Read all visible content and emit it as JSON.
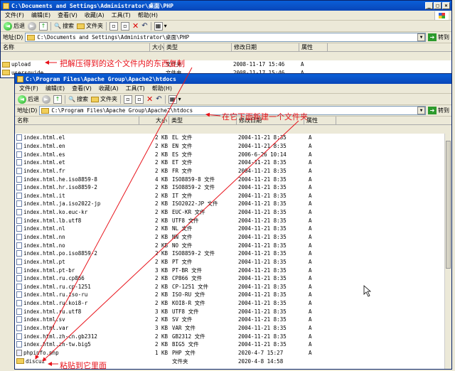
{
  "back_window": {
    "title": "C:\\Documents and Settings\\Administrator\\桌面\\PHP",
    "menu": [
      "文件(F)",
      "编辑(E)",
      "查看(V)",
      "收藏(A)",
      "工具(T)",
      "帮助(H)"
    ],
    "toolbar": {
      "back": "后退",
      "search": "搜索",
      "folders": "文件夹"
    },
    "address_label": "地址(D)",
    "address": "C:\\Documents and Settings\\Administrator\\桌面\\PHP",
    "go": "转到",
    "columns": [
      "名称",
      "大小",
      "类型",
      "修改日期",
      "属性"
    ],
    "rows": [
      {
        "name": "upload",
        "size": "",
        "type": "文件夹",
        "date": "2008-11-17 15:46",
        "attr": "A"
      },
      {
        "name": "usersguide",
        "size": "",
        "type": "文件夹",
        "date": "2008-11-17 15:46",
        "attr": "A"
      }
    ]
  },
  "front_window": {
    "title": "C:\\Program Files\\Apache Group\\Apache2\\htdocs",
    "menu": [
      "文件(F)",
      "编辑(E)",
      "查看(V)",
      "收藏(A)",
      "工具(T)",
      "帮助(H)"
    ],
    "toolbar": {
      "back": "后退",
      "search": "搜索",
      "folders": "文件夹"
    },
    "address_label": "地址(D)",
    "address": "C:\\Program Files\\Apache Group\\Apache2\\htdocs",
    "go": "转到",
    "columns": [
      "名称",
      "大小",
      "类型",
      "修改日期",
      "属性"
    ],
    "rows": [
      {
        "name": "index.html.el",
        "size": "2 KB",
        "type": "EL 文件",
        "date": "2004-11-21 8:35",
        "attr": "A"
      },
      {
        "name": "index.html.en",
        "size": "2 KB",
        "type": "EN 文件",
        "date": "2004-11-21 8:35",
        "attr": "A"
      },
      {
        "name": "index.html.es",
        "size": "2 KB",
        "type": "ES 文件",
        "date": "2006-6-26 10:14",
        "attr": "A"
      },
      {
        "name": "index.html.et",
        "size": "2 KB",
        "type": "ET 文件",
        "date": "2004-11-21 8:35",
        "attr": "A"
      },
      {
        "name": "index.html.fr",
        "size": "2 KB",
        "type": "FR 文件",
        "date": "2004-11-21 8:35",
        "attr": "A"
      },
      {
        "name": "index.html.he.iso8859-8",
        "size": "4 KB",
        "type": "ISO8859-8 文件",
        "date": "2004-11-21 8:35",
        "attr": "A"
      },
      {
        "name": "index.html.hr.iso8859-2",
        "size": "2 KB",
        "type": "ISO8859-2 文件",
        "date": "2004-11-21 8:35",
        "attr": "A"
      },
      {
        "name": "index.html.it",
        "size": "2 KB",
        "type": "IT 文件",
        "date": "2004-11-21 8:35",
        "attr": "A"
      },
      {
        "name": "index.html.ja.iso2022-jp",
        "size": "2 KB",
        "type": "ISO2022-JP 文件",
        "date": "2004-11-21 8:35",
        "attr": "A"
      },
      {
        "name": "index.html.ko.euc-kr",
        "size": "2 KB",
        "type": "EUC-KR 文件",
        "date": "2004-11-21 8:35",
        "attr": "A"
      },
      {
        "name": "index.html.lb.utf8",
        "size": "2 KB",
        "type": "UTF8 文件",
        "date": "2004-11-21 8:35",
        "attr": "A"
      },
      {
        "name": "index.html.nl",
        "size": "2 KB",
        "type": "NL 文件",
        "date": "2004-11-21 8:35",
        "attr": "A"
      },
      {
        "name": "index.html.nn",
        "size": "2 KB",
        "type": "NN 文件",
        "date": "2004-11-21 8:35",
        "attr": "A"
      },
      {
        "name": "index.html.no",
        "size": "2 KB",
        "type": "NO 文件",
        "date": "2004-11-21 8:35",
        "attr": "A"
      },
      {
        "name": "index.html.po.iso8859-2",
        "size": "2 KB",
        "type": "ISO8859-2 文件",
        "date": "2004-11-21 8:35",
        "attr": "A"
      },
      {
        "name": "index.html.pt",
        "size": "2 KB",
        "type": "PT 文件",
        "date": "2004-11-21 8:35",
        "attr": "A"
      },
      {
        "name": "index.html.pt-br",
        "size": "3 KB",
        "type": "PT-BR 文件",
        "date": "2004-11-21 8:35",
        "attr": "A"
      },
      {
        "name": "index.html.ru.cp866",
        "size": "2 KB",
        "type": "CP866 文件",
        "date": "2004-11-21 8:35",
        "attr": "A"
      },
      {
        "name": "index.html.ru.cp-1251",
        "size": "2 KB",
        "type": "CP-1251 文件",
        "date": "2004-11-21 8:35",
        "attr": "A"
      },
      {
        "name": "index.html.ru.iso-ru",
        "size": "2 KB",
        "type": "ISO-RU 文件",
        "date": "2004-11-21 8:35",
        "attr": "A"
      },
      {
        "name": "index.html.ru.koi8-r",
        "size": "2 KB",
        "type": "KOI8-R 文件",
        "date": "2004-11-21 8:35",
        "attr": "A"
      },
      {
        "name": "index.html.ru.utf8",
        "size": "3 KB",
        "type": "UTF8 文件",
        "date": "2004-11-21 8:35",
        "attr": "A"
      },
      {
        "name": "index.html.sv",
        "size": "2 KB",
        "type": "SV 文件",
        "date": "2004-11-21 8:35",
        "attr": "A"
      },
      {
        "name": "index.html.var",
        "size": "3 KB",
        "type": "VAR 文件",
        "date": "2004-11-21 8:35",
        "attr": "A"
      },
      {
        "name": "index.html.zh-cn.gb2312",
        "size": "2 KB",
        "type": "GB2312 文件",
        "date": "2004-11-21 8:35",
        "attr": "A"
      },
      {
        "name": "index.html.zh-tw.big5",
        "size": "2 KB",
        "type": "BIG5 文件",
        "date": "2004-11-21 8:35",
        "attr": "A"
      },
      {
        "name": "phpinfo.php",
        "size": "1 KB",
        "type": "PHP 文件",
        "date": "2020-4-7 15:27",
        "attr": "A"
      },
      {
        "name": "discuz",
        "size": "",
        "type": "文件夹",
        "date": "2020-4-8 14:58",
        "attr": ""
      }
    ]
  },
  "annotations": {
    "copy": "把解压得到的这个文件内的东西复制",
    "new_folder": "在它下面新建一个文件夹",
    "paste": "粘贴到它里面"
  },
  "colors": {
    "annotation": "#e8121a",
    "title_bar": "#0a5fd8"
  }
}
